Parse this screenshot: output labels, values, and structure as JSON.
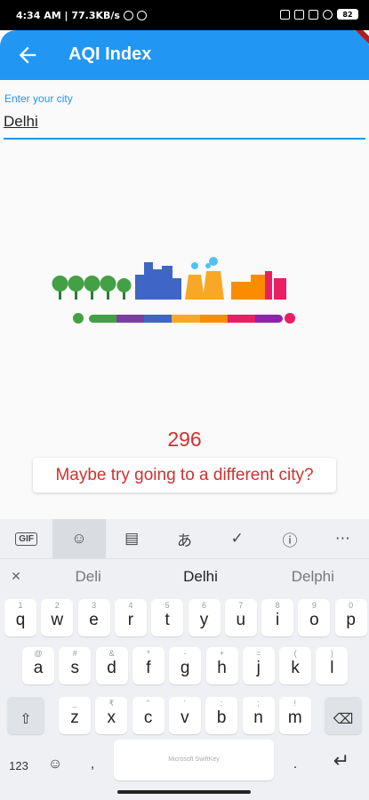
{
  "status_bar": {
    "time_speed": "4:34 AM | 77.3KB/s",
    "battery": "82"
  },
  "app_bar": {
    "title": "AQI Index",
    "back_icon": "arrow-left-icon",
    "color": "#2196F3"
  },
  "city_field": {
    "label": "Enter your city",
    "value": "Delhi"
  },
  "aqi": {
    "value": "296",
    "message": "Maybe try going to a different city?",
    "color": "#d32f2f",
    "scale_colors": [
      "#43a047",
      "#7b3fa0",
      "#3f66c7",
      "#f9a825",
      "#fb8c00",
      "#e91e63",
      "#8e24aa"
    ]
  },
  "keyboard": {
    "toolbar": [
      "GIF",
      "sticker-icon",
      "clipboard-icon",
      "translate-icon",
      "check-icon",
      "info-icon",
      "more-icon"
    ],
    "suggestions": [
      "Deli",
      "Delhi",
      "Delphi"
    ],
    "row1": [
      {
        "ch": "q",
        "hint": "1"
      },
      {
        "ch": "w",
        "hint": "2"
      },
      {
        "ch": "e",
        "hint": "3"
      },
      {
        "ch": "r",
        "hint": "4"
      },
      {
        "ch": "t",
        "hint": "5"
      },
      {
        "ch": "y",
        "hint": "6"
      },
      {
        "ch": "u",
        "hint": "7"
      },
      {
        "ch": "i",
        "hint": "8"
      },
      {
        "ch": "o",
        "hint": "9"
      },
      {
        "ch": "p",
        "hint": "0"
      }
    ],
    "row2": [
      {
        "ch": "a",
        "hint": "@"
      },
      {
        "ch": "s",
        "hint": "#"
      },
      {
        "ch": "d",
        "hint": "&"
      },
      {
        "ch": "f",
        "hint": "*"
      },
      {
        "ch": "g",
        "hint": "-"
      },
      {
        "ch": "h",
        "hint": "+"
      },
      {
        "ch": "j",
        "hint": "="
      },
      {
        "ch": "k",
        "hint": "("
      },
      {
        "ch": "l",
        "hint": ")"
      }
    ],
    "row3": [
      {
        "ch": "z",
        "hint": "_"
      },
      {
        "ch": "x",
        "hint": "₹"
      },
      {
        "ch": "c",
        "hint": "\""
      },
      {
        "ch": "v",
        "hint": "'"
      },
      {
        "ch": "b",
        "hint": ":"
      },
      {
        "ch": "n",
        "hint": ";"
      },
      {
        "ch": "m",
        "hint": "!"
      }
    ],
    "shift": "⇧",
    "backspace": "⌫",
    "numbers": "123",
    "emoji": "☺",
    "comma": ",",
    "space_label": "Microsoft SwiftKey",
    "period": ".",
    "enter": "↵"
  }
}
